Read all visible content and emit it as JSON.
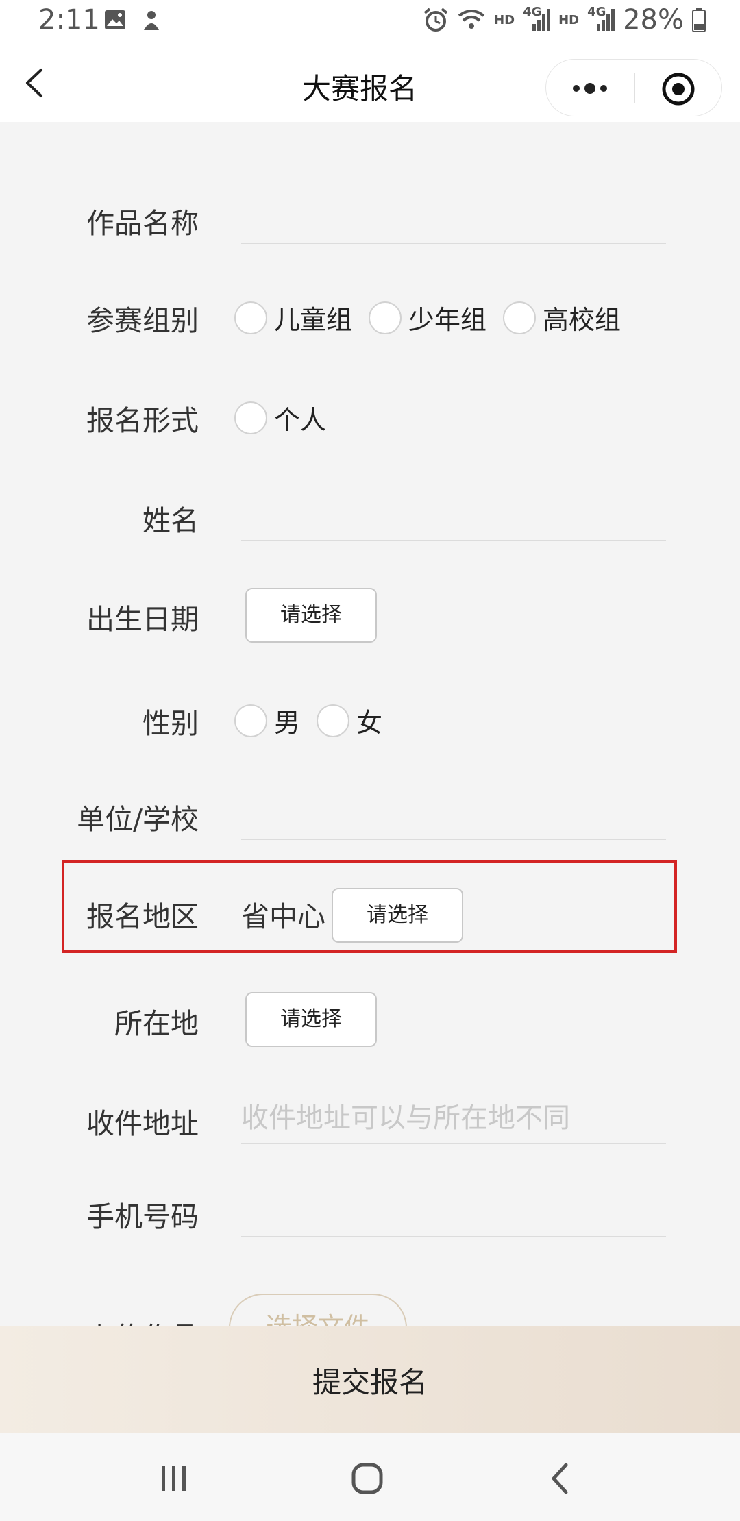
{
  "status_bar": {
    "time": "2:11",
    "battery": "28%",
    "hd1": "HD",
    "net1": "4G",
    "hd2": "HD",
    "net2": "4G"
  },
  "navbar": {
    "title": "大赛报名"
  },
  "form": {
    "work_name_label": "作品名称",
    "group_label": "参赛组别",
    "group_options": [
      "儿童组",
      "少年组",
      "高校组"
    ],
    "entry_type_label": "报名形式",
    "entry_type_options": [
      "个人"
    ],
    "name_label": "姓名",
    "birth_label": "出生日期",
    "birth_button": "请选择",
    "gender_label": "性别",
    "gender_options": [
      "男",
      "女"
    ],
    "school_label": "单位/学校",
    "region_label": "报名地区",
    "region_value": "省中心",
    "region_button": "请选择",
    "location_label": "所在地",
    "location_button": "请选择",
    "address_label": "收件地址",
    "address_placeholder": "收件地址可以与所在地不同",
    "phone_label": "手机号码",
    "upload_label": "上传作品",
    "upload_button": "选择文件"
  },
  "submit": {
    "label": "提交报名"
  },
  "colors": {
    "highlight": "#d32424",
    "submit_bg": "#efe6db",
    "page_bg": "#f4f4f4"
  }
}
